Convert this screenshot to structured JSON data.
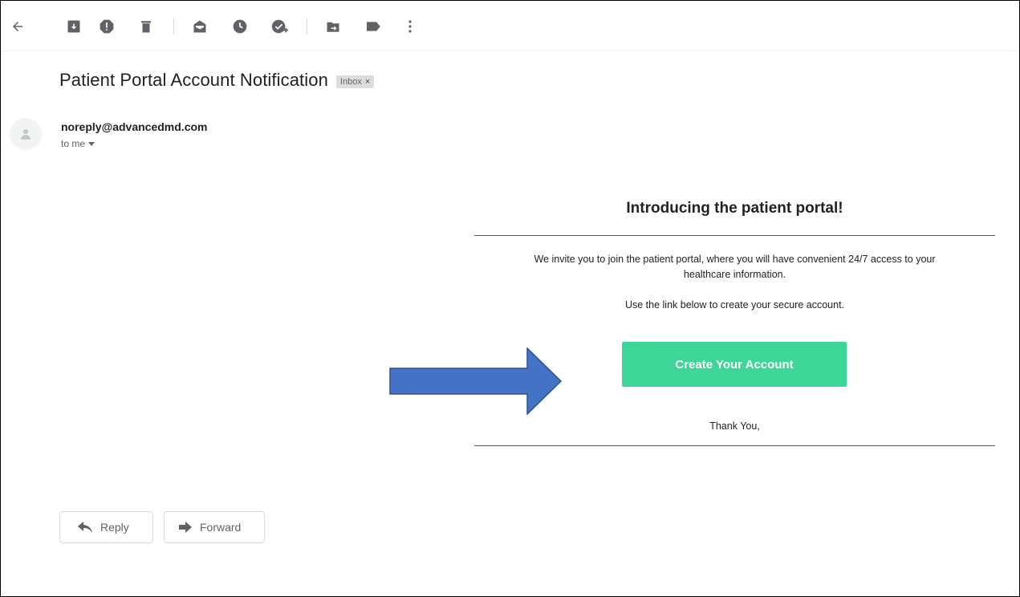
{
  "toolbar": {
    "icons": [
      "back-arrow-icon",
      "archive-icon",
      "report-spam-icon",
      "delete-icon",
      "mark-unread-icon",
      "snooze-icon",
      "add-to-tasks-icon",
      "move-to-icon",
      "label-icon",
      "more-vert-icon"
    ]
  },
  "email": {
    "subject": "Patient Portal Account Notification",
    "label_chip": "Inbox",
    "label_chip_close": "×",
    "sender": "noreply@advancedmd.com",
    "recipient": "to me"
  },
  "body": {
    "title": "Introducing the patient portal!",
    "paragraph1_line1": "We invite you to join the patient portal, where you will have convenient 24/7 access to your",
    "paragraph1_line2": "healthcare information.",
    "paragraph2": "Use the link below to create your secure account.",
    "cta_label": "Create Your Account",
    "signoff": "Thank You,"
  },
  "actions": {
    "reply_label": "Reply",
    "forward_label": "Forward"
  },
  "colors": {
    "cta_background": "#3dd598",
    "annotation_arrow": "#4472c4",
    "annotation_arrow_border": "#2f528f"
  }
}
